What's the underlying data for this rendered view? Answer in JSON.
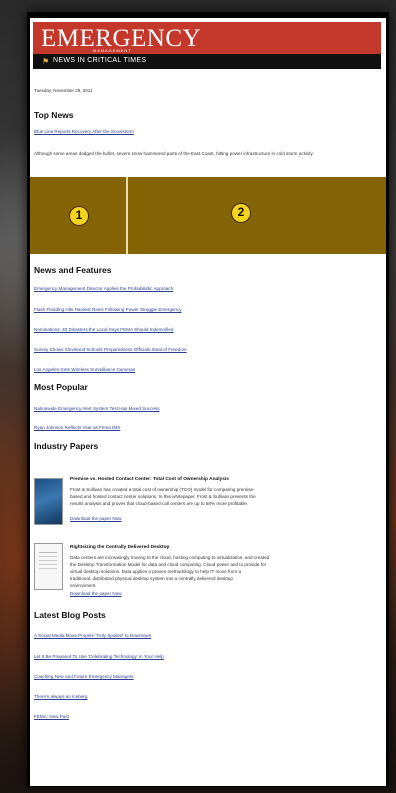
{
  "masthead": {
    "logo": "EMERGENCY",
    "logo_sub": "MANAGEMENT",
    "tagline": "NEWS IN CRITICAL TIMES",
    "tagline_icon": "flag-icon"
  },
  "date": "Tuesday, November 29, 2011",
  "top_news": {
    "title": "Top News",
    "headline": "Blue Line Reports Recovery After the Snowstorm",
    "summary": "Although some areas dodged the bullet, severe snow hammered parts of the East Coast, hitting power infrastructure in cold storm activity."
  },
  "banner": {
    "color": "#846405",
    "markers": [
      "1",
      "2"
    ]
  },
  "news_features": {
    "title": "News and Features",
    "items": [
      "Emergency Management Director Applies the Probabilistic Approach",
      "Flash Flooding Hits Hardest Rains Following Power Struggle Emergency",
      "Nominations: 40 Disasters the Local Says FEMA Should Indemnified",
      "Survey Shows Cleveland Schools Preparedness Officials Steal of Freedom",
      "Los Angeles Gets Wireless Surveillance Cameras"
    ]
  },
  "most_popular": {
    "title": "Most Popular",
    "items": [
      "Nationwide Emergency Alert System Test Has Mixed Success",
      "Ryan Johnson Reflects Year as Fema IMS"
    ]
  },
  "industry_papers": {
    "title": "Industry Papers",
    "papers": [
      {
        "title": "Premise vs. Hosted Contact Center: Total Cost of Ownership Analysis",
        "lines": [
          "Frost & Sullivan has created a total cost of ownership (TCO) model for comparing premise-",
          "based and hosted contact center solutions. In this whitepaper, Frost & Sullivan presents the",
          "results analysis and proves that cloud-based call centers are up to 58% more profitable."
        ],
        "link": "Download the paper Now"
      },
      {
        "title": "Rightsizing the Centrally Delivered Desktop",
        "lines": [
          "Data centers are increasingly moving to the cloud, hosting computing to virtualization, and created",
          "the Desktop Transformation Model for data and cloud computing. Cloud power and to provide for",
          "virtual desktop solutions. Data applies a proven methodology to help IT move from a",
          "traditional, distributed physical desktop system into a centrally delivered desktop",
          "environment."
        ],
        "link": "Download the paper Now"
      }
    ]
  },
  "blog": {
    "title": "Latest Blog Posts",
    "items": [
      "A Social Media Move Propels 'Truly Spoiled' to Downtown",
      "Let It Be Prepared To Use 'Celebrating Technology' in Your Help",
      "Coaching New and Future Emergency Managers",
      "There's always an Iceberg",
      "FEMA: Now Past"
    ]
  }
}
